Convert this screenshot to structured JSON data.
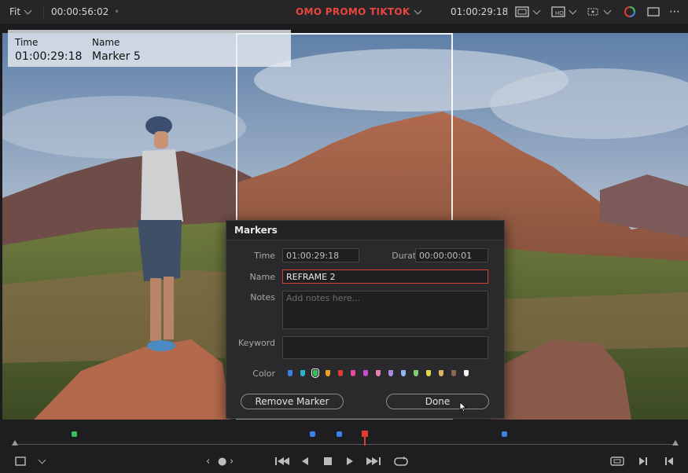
{
  "topbar": {
    "zoom_label": "Fit",
    "duration": "00:00:56:02",
    "project_title": "OMO PROMO TIKTOK",
    "timecode": "01:00:29:18"
  },
  "info": {
    "time_label": "Time",
    "time_value": "01:00:29:18",
    "name_label": "Name",
    "name_value": "Marker 5"
  },
  "dialog": {
    "title": "Markers",
    "time_label": "Time",
    "time_value": "01:00:29:18",
    "duration_label": "Duration",
    "duration_value": "00:00:00:01",
    "name_label": "Name",
    "name_value": "REFRAME 2",
    "notes_label": "Notes",
    "notes_placeholder": "Add notes here...",
    "keyword_label": "Keyword",
    "keyword_value": "",
    "color_label": "Color",
    "colors": [
      "#3b82e6",
      "#2bb3c8",
      "#34c05a",
      "#f0a020",
      "#e03b32",
      "#e24aa0",
      "#c84bd0",
      "#e57fb0",
      "#a98ae6",
      "#8fb7ef",
      "#7fd06a",
      "#d9d94a",
      "#e0b060",
      "#8a6a4a",
      "#f2f2f2"
    ],
    "selected_color": "#34c05a",
    "remove_button": "Remove Marker",
    "done_button": "Done"
  },
  "timeline": {
    "markers": [
      {
        "color": "#34c05a",
        "position": 0.09
      },
      {
        "color": "#3b82e6",
        "position": 0.45
      },
      {
        "color": "#3b82e6",
        "position": 0.49
      },
      {
        "color": "#3b82e6",
        "position": 0.74
      }
    ],
    "playhead_position": 0.53
  }
}
